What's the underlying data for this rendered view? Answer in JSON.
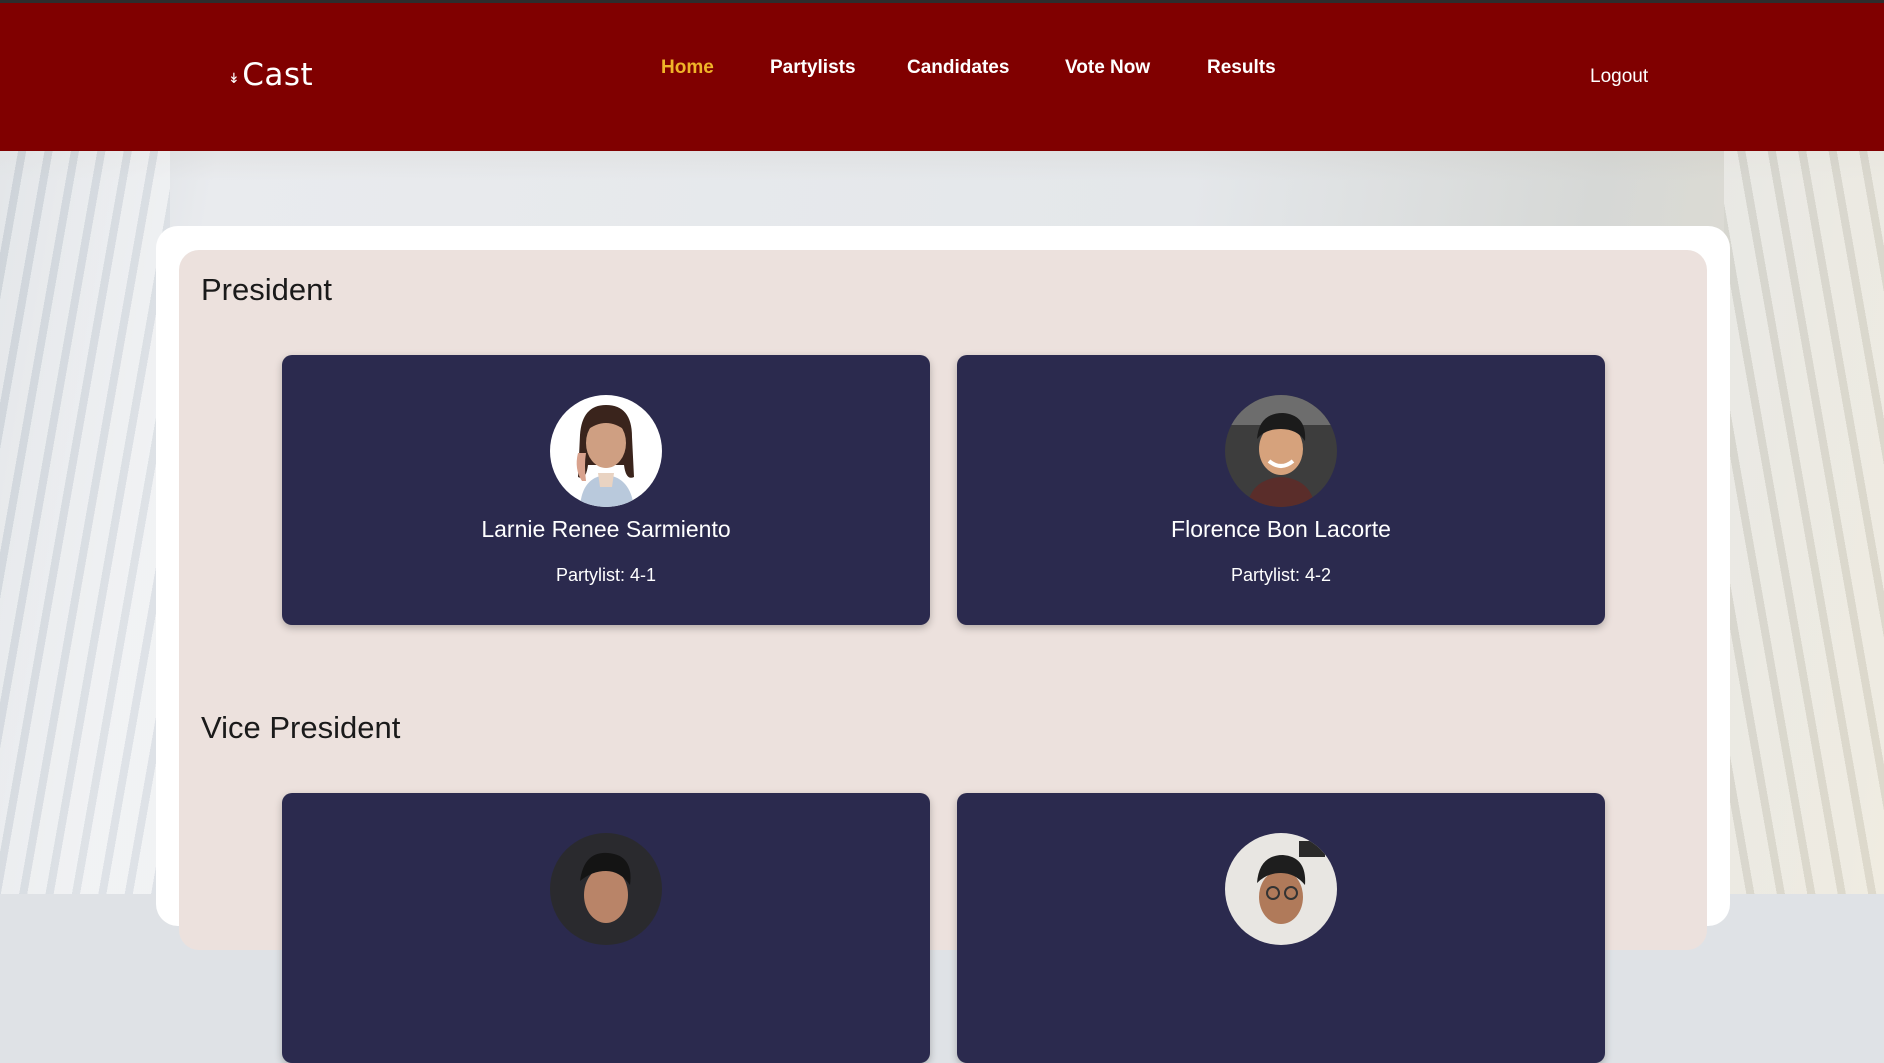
{
  "brand": {
    "name": "Cast",
    "mark": "↡"
  },
  "nav": [
    {
      "label": "Home",
      "active": true
    },
    {
      "label": "Partylists",
      "active": false
    },
    {
      "label": "Candidates",
      "active": false
    },
    {
      "label": "Vote Now",
      "active": false
    },
    {
      "label": "Results",
      "active": false
    }
  ],
  "logout_label": "Logout",
  "colors": {
    "header": "#800000",
    "active_nav": "#f0b429",
    "card": "#2b2a4e",
    "panel": "#ece1dd"
  },
  "sections": [
    {
      "title": "President",
      "candidates": [
        {
          "name": "Larnie Renee Sarmiento",
          "partylist": "Partylist: 4-1"
        },
        {
          "name": "Florence Bon Lacorte",
          "partylist": "Partylist: 4-2"
        }
      ]
    },
    {
      "title": "Vice President",
      "candidates": [
        {
          "name": "",
          "partylist": ""
        },
        {
          "name": "",
          "partylist": ""
        }
      ]
    }
  ]
}
